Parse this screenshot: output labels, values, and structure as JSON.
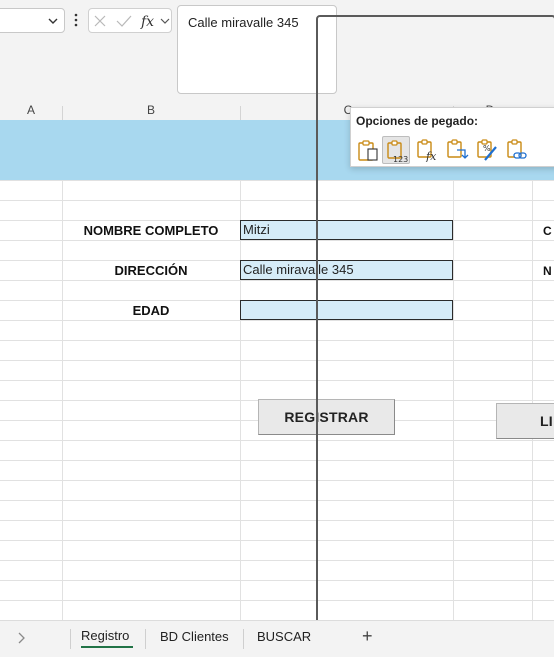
{
  "formula_bar": {
    "name_box_value": "",
    "formula_value": "Calle miravalle 345",
    "cancel_icon": "close-icon",
    "enter_icon": "check-icon",
    "function_icon": "fx-icon"
  },
  "columns": [
    "A",
    "B",
    "C",
    "D"
  ],
  "form": {
    "fields": [
      {
        "label": "NOMBRE COMPLETO",
        "value": "Mitzi"
      },
      {
        "label": "DIRECCIÓN",
        "value": "Calle miravalle 345"
      },
      {
        "label": "EDAD",
        "value": ""
      }
    ],
    "right_labels": [
      "C",
      "N"
    ],
    "register_button": "REGISTRAR",
    "clear_button": "LI"
  },
  "paste_options": {
    "title": "Opciones de pegado:",
    "options": [
      "paste-icon",
      "paste-values-icon",
      "paste-formulas-icon",
      "transpose-icon",
      "paste-formatting-icon",
      "paste-link-icon"
    ]
  },
  "sheet_tabs": {
    "tabs": [
      "Registro",
      "BD Clientes",
      "BUSCAR"
    ],
    "active": "Registro",
    "add_label": "+"
  },
  "colors": {
    "banner": "#a8d8ef",
    "input_fill": "#d6ecf8",
    "active_tab_underline": "#217346",
    "clipboard": "#c98a14"
  }
}
